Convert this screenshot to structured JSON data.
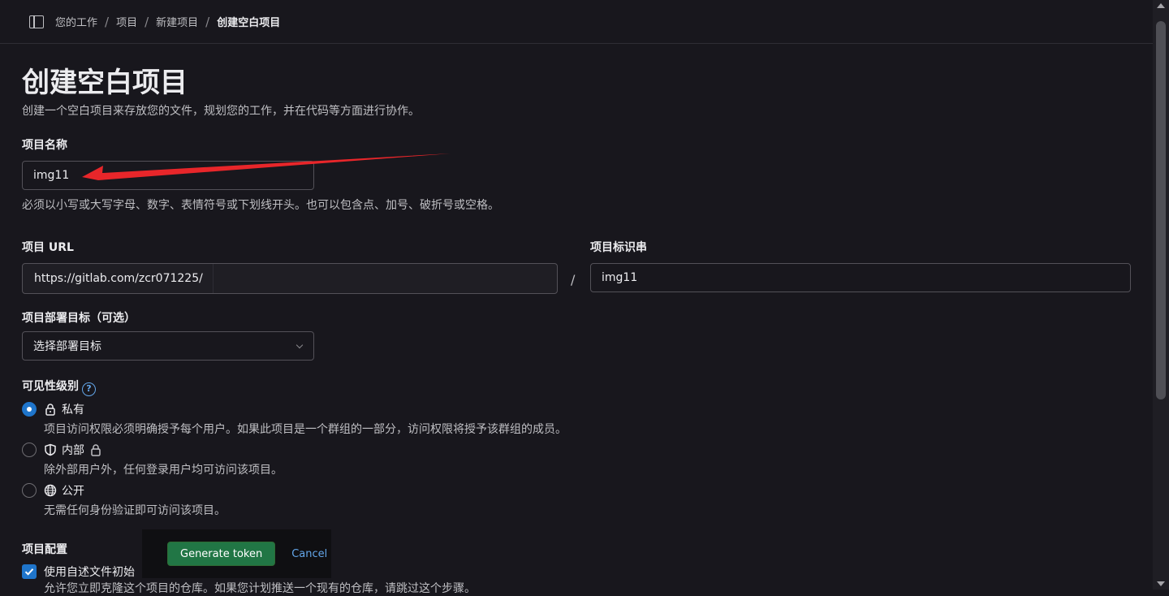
{
  "breadcrumb": {
    "items": [
      "您的工作",
      "项目",
      "新建项目",
      "创建空白项目"
    ],
    "separator": "/"
  },
  "page": {
    "title": "创建空白项目",
    "subtitle": "创建一个空白项目来存放您的文件，规划您的工作，并在代码等方面进行协作。"
  },
  "project_name": {
    "label": "项目名称",
    "value": "img11",
    "help": "必须以小写或大写字母、数字、表情符号或下划线开头。也可以包含点、加号、破折号或空格。"
  },
  "project_url": {
    "label": "项目 URL",
    "prefix": "https://gitlab.com/zcr071225/",
    "separator": "/"
  },
  "project_slug": {
    "label": "项目标识串",
    "value": "img11"
  },
  "deploy_target": {
    "label": "项目部署目标（可选）",
    "selected": "选择部署目标"
  },
  "visibility": {
    "label": "可见性级别",
    "help_icon": "question-circle-icon",
    "options": [
      {
        "label": "私有",
        "description": "项目访问权限必须明确授予每个用户。如果此项目是一个群组的一部分，访问权限将授予该群组的成员。",
        "checked": true,
        "icon": "lock-icon"
      },
      {
        "label": "内部",
        "description": "除外部用户外，任何登录用户均可访问该项目。",
        "checked": false,
        "icon": "shield-icon"
      },
      {
        "label": "公开",
        "description": "无需任何身份验证即可访问该项目。",
        "checked": false,
        "icon": "earth-icon"
      }
    ]
  },
  "project_config": {
    "label": "项目配置",
    "readme_label": "使用自述文件初始",
    "readme_checked": true,
    "readme_description": "允许您立即克隆这个项目的仓库。如果您计划推送一个现有的仓库，请跳过这个步骤。"
  },
  "footer": {
    "confirm_label": "Generate token",
    "cancel_label": "Cancel"
  },
  "annotation": {
    "arrow_color": "#e8262a"
  },
  "colors": {
    "background": "#18171d",
    "accent": "#1f75cb",
    "confirm": "#217645",
    "link": "#63a6e9"
  }
}
